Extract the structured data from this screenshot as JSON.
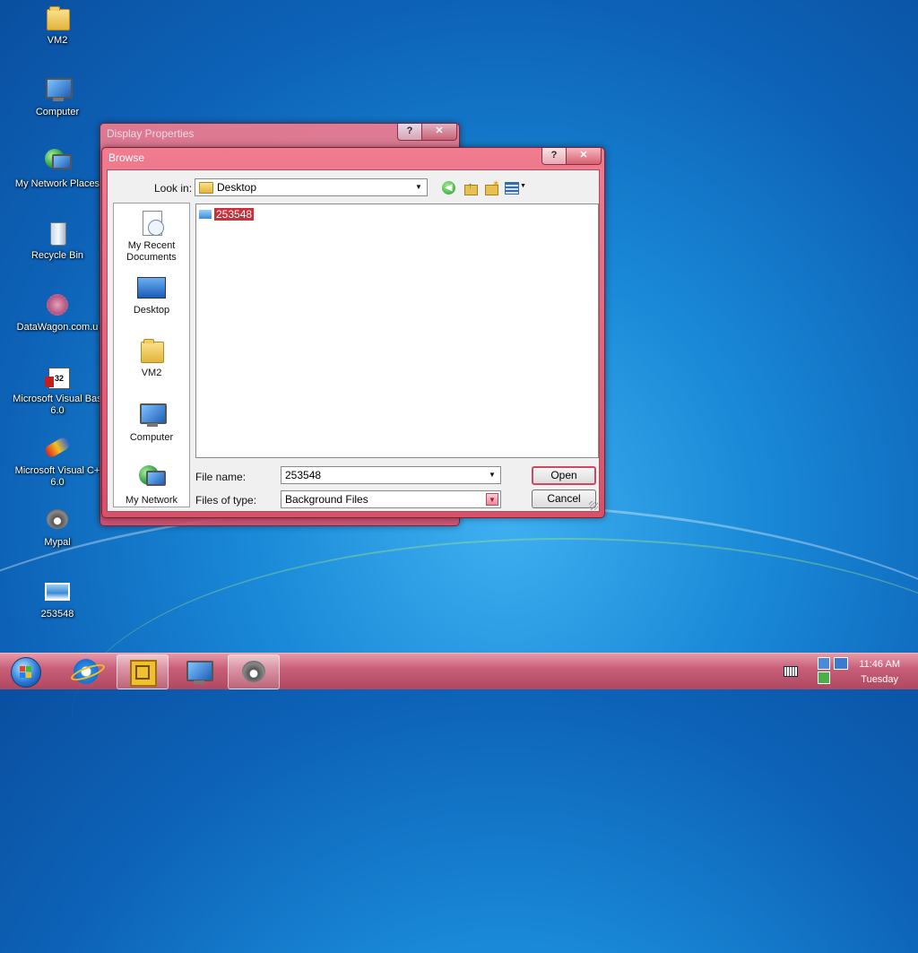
{
  "desktop": {
    "icons": [
      {
        "label": "VM2",
        "icon": "folder-icon"
      },
      {
        "label": "Computer",
        "icon": "computer-icon"
      },
      {
        "label": "My Network Places",
        "icon": "network-icon"
      },
      {
        "label": "Recycle Bin",
        "icon": "recycle-bin-icon"
      },
      {
        "label": "DataWagon.com.u",
        "icon": "datawagon-icon"
      },
      {
        "label": "Microsoft Visual Bas\n6.0",
        "icon": "vb6-icon"
      },
      {
        "label": "Microsoft Visual C+\n6.0",
        "icon": "vc6-icon"
      },
      {
        "label": "Mypal",
        "icon": "mypal-icon"
      },
      {
        "label": "253548",
        "icon": "image-file-icon"
      }
    ]
  },
  "display_properties": {
    "title": "Display Properties",
    "help_glyph": "?",
    "close_glyph": "✕"
  },
  "browse": {
    "title": "Browse",
    "help_glyph": "?",
    "close_glyph": "✕",
    "look_in_label": "Look in:",
    "look_in_value": "Desktop",
    "places": [
      {
        "label": "My Recent\nDocuments",
        "icon": "recent-documents-icon"
      },
      {
        "label": "Desktop",
        "icon": "desktop-icon"
      },
      {
        "label": "VM2",
        "icon": "folder-icon"
      },
      {
        "label": "Computer",
        "icon": "computer-icon"
      },
      {
        "label": "My Network",
        "icon": "network-icon"
      }
    ],
    "files": [
      {
        "name": "253548",
        "selected": true
      }
    ],
    "file_name_label": "File name:",
    "file_name_value": "253548",
    "files_of_type_label": "Files of type:",
    "files_of_type_value": "Background Files",
    "open_label": "Open",
    "cancel_label": "Cancel"
  },
  "taskbar": {
    "clock_time": "11:46 AM",
    "clock_day": "Tuesday",
    "buttons": [
      {
        "name": "start-button",
        "icon": "windows-orb-icon"
      },
      {
        "name": "internet-explorer",
        "icon": "ie-icon"
      },
      {
        "name": "vmware",
        "icon": "vmware-icon",
        "active": true
      },
      {
        "name": "computer",
        "icon": "computer-icon"
      },
      {
        "name": "mypal",
        "icon": "mypal-icon",
        "active": true
      }
    ]
  },
  "colors": {
    "accent": "#d8506a",
    "selection": "#c8303a"
  }
}
